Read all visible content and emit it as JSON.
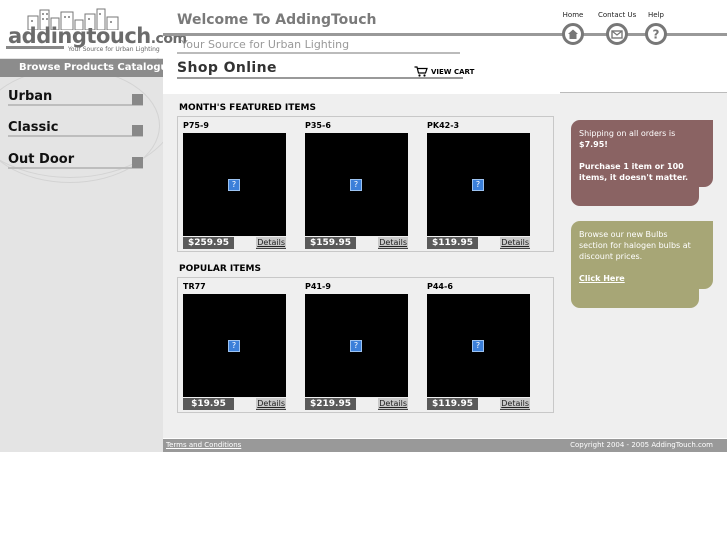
{
  "header": {
    "logo_word": "addingtouch",
    "logo_tld": ".com",
    "logo_tagline": "Your Source for Urban Lighting",
    "welcome": "Welcome To AddingTouch",
    "tagline": "Your Source for Urban Lighting",
    "nav": [
      {
        "label": "Home",
        "icon": "home-icon"
      },
      {
        "label": "Contact Us",
        "icon": "mail-icon"
      },
      {
        "label": "Help",
        "icon": "help-icon"
      }
    ]
  },
  "sidebar": {
    "browse_label": "Browse Products Catalogue",
    "categories": [
      "Urban",
      "Classic",
      "Out Door"
    ]
  },
  "main": {
    "title": "Shop Online",
    "view_cart": "VIEW CART",
    "featured": {
      "title": "MONTH'S FEATURED ITEMS",
      "items": [
        {
          "code": "P75-9",
          "price": "$259.95",
          "details": "Details"
        },
        {
          "code": "P35-6",
          "price": "$159.95",
          "details": "Details"
        },
        {
          "code": "PK42-3",
          "price": "$119.95",
          "details": "Details"
        }
      ]
    },
    "popular": {
      "title": "POPULAR ITEMS",
      "items": [
        {
          "code": "TR77",
          "price": "$19.95",
          "details": "Details"
        },
        {
          "code": "P41-9",
          "price": "$219.95",
          "details": "Details"
        },
        {
          "code": "P44-6",
          "price": "$119.95",
          "details": "Details"
        }
      ]
    },
    "placeholder_glyph": "?"
  },
  "promos": {
    "shipping_line1": "Shipping on all orders is",
    "shipping_price": "$7.95!",
    "shipping_line2": "Purchase 1 item or 100 items, it doesn't matter.",
    "bulbs_text": "Browse our new Bulbs section for halogen bulbs at discount prices.",
    "bulbs_link": "Click Here"
  },
  "footer": {
    "terms": "Terms and Conditions",
    "copyright": "Copyright 2004 - 2005 AddingTouch.com"
  },
  "colors": {
    "promo_shipping": "#8a6363",
    "promo_bulbs": "#a7a676",
    "footer_bg": "#999999",
    "browse_bar": "#8c8c8c",
    "sidebar_bg": "#e4e4e4"
  }
}
